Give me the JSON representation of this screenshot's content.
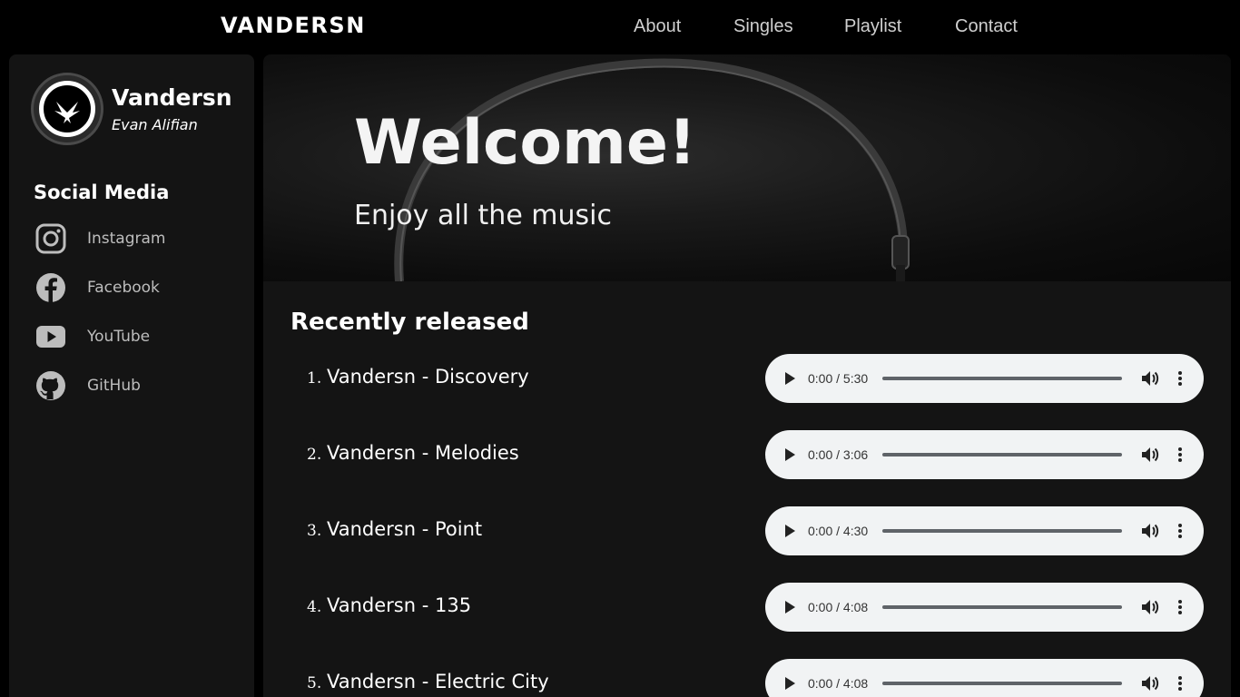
{
  "header": {
    "logo": "VANDERSN",
    "nav": [
      {
        "label": "About"
      },
      {
        "label": "Singles"
      },
      {
        "label": "Playlist"
      },
      {
        "label": "Contact"
      }
    ]
  },
  "sidebar": {
    "artist_name": "Vandersn",
    "artist_real_name": "Evan Alifian",
    "social_title": "Social Media",
    "social": [
      {
        "label": "Instagram",
        "icon": "instagram-icon"
      },
      {
        "label": "Facebook",
        "icon": "facebook-icon"
      },
      {
        "label": "YouTube",
        "icon": "youtube-icon"
      },
      {
        "label": "GitHub",
        "icon": "github-icon"
      }
    ]
  },
  "hero": {
    "title": "Welcome!",
    "subtitle": "Enjoy all the music"
  },
  "main": {
    "section_title": "Recently released",
    "tracks": [
      {
        "number": "1.",
        "title": "Vandersn - Discovery",
        "time": "0:00 / 5:30"
      },
      {
        "number": "2.",
        "title": "Vandersn - Melodies",
        "time": "0:00 / 3:06"
      },
      {
        "number": "3.",
        "title": "Vandersn - Point",
        "time": "0:00 / 4:30"
      },
      {
        "number": "4.",
        "title": "Vandersn - 135",
        "time": "0:00 / 4:08"
      },
      {
        "number": "5.",
        "title": "Vandersn - Electric City",
        "time": "0:00 / 4:08"
      }
    ]
  },
  "colors": {
    "page_bg": "#000000",
    "panel_bg": "#141414",
    "player_bg": "#f1f3f4",
    "nav_text": "#cfcfcf",
    "social_text": "#bdbdbd"
  }
}
